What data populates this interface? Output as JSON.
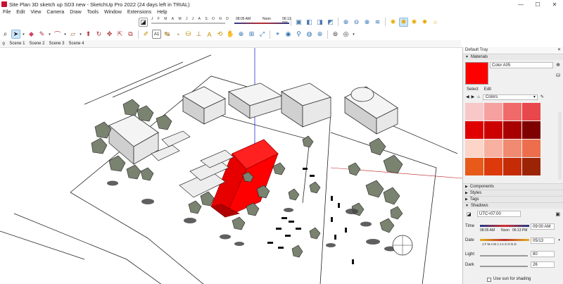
{
  "window": {
    "title": "Site Plan 3D sketch up SD3 new - SketchUp Pro 2022 (24 days left in TRIAL)",
    "minimize": "—",
    "maximize": "☐",
    "close": "✕"
  },
  "menu": [
    "File",
    "Edit",
    "View",
    "Camera",
    "Draw",
    "Tools",
    "Window",
    "Extensions",
    "Help"
  ],
  "sun_toolbar": {
    "months": [
      "J",
      "F",
      "M",
      "A",
      "M",
      "J",
      "J",
      "A",
      "S",
      "O",
      "N",
      "D"
    ],
    "sunrise": "08:05 AM",
    "noon": "Noon",
    "sunset": "06:13 PM"
  },
  "scenes": [
    "Scene 1",
    "Scene 2",
    "Scene 3",
    "Scene 4"
  ],
  "tray": {
    "title": "Default Tray",
    "materials": {
      "header": "Materials",
      "name": "Color A05",
      "swatch_color": "#ff0000",
      "tab_select": "Select",
      "tab_edit": "Edit",
      "collection": "Colors",
      "swatches": [
        "#f8c8c8",
        "#f7a0a0",
        "#f06a6a",
        "#e8484c",
        "#e10000",
        "#cc0000",
        "#a80000",
        "#7e0000",
        "#fcd4c8",
        "#f8b0a0",
        "#f08a70",
        "#ec6e4c",
        "#e85a1a",
        "#dc3a0c",
        "#c42c08",
        "#9c2406"
      ]
    },
    "sections": [
      "Components",
      "Styles",
      "Tags",
      "Shadows"
    ],
    "shadows": {
      "timezone": "UTC+07:00",
      "time_label": "Time",
      "time_start": "08:05 AM",
      "time_noon": "Noon",
      "time_end": "06:13 PM",
      "time_value": "09:00 AM",
      "date_label": "Date",
      "months": "J F M A M J J A S O N D",
      "date_value": "05/13",
      "light_label": "Light",
      "light_value": "80",
      "dark_label": "Dark",
      "dark_value": "26",
      "use_sun": "Use sun for shading"
    }
  }
}
